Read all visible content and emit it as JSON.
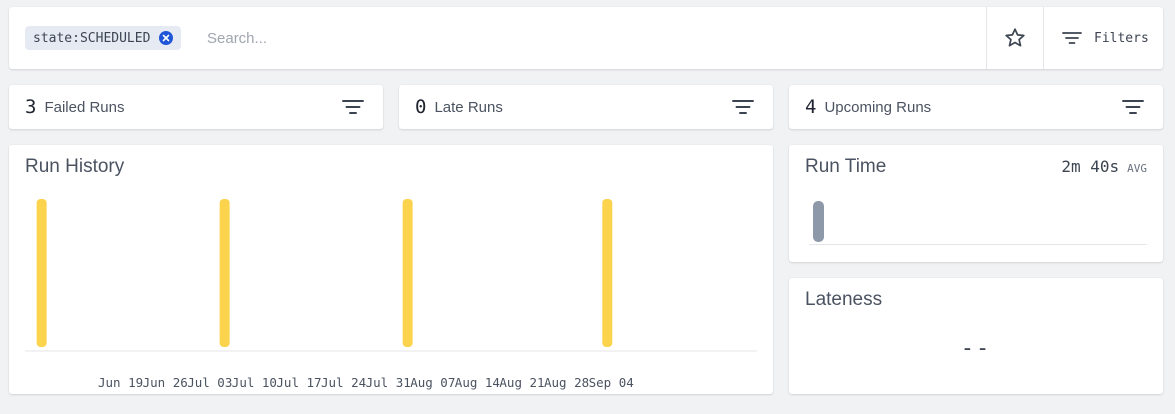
{
  "search": {
    "chip_label": "state:SCHEDULED",
    "placeholder": "Search...",
    "filters_label": "Filters"
  },
  "stats": [
    {
      "count": "3",
      "label": "Failed Runs"
    },
    {
      "count": "0",
      "label": "Late Runs"
    },
    {
      "count": "4",
      "label": "Upcoming Runs"
    }
  ],
  "run_history": {
    "title": "Run History"
  },
  "run_time": {
    "title": "Run Time",
    "avg_value": "2m 40s",
    "avg_label": "AVG"
  },
  "lateness": {
    "title": "Lateness",
    "value": "--"
  },
  "colors": {
    "scheduled_bar": "#fcd34d",
    "chip_remove": "#1f55d6",
    "run_time_bar": "#8d99a8"
  },
  "chart_data": {
    "type": "bar",
    "x_tick_labels": [
      "Jun 19",
      "Jun 26",
      "Jul 03",
      "Jul 10",
      "Jul 17",
      "Jul 24",
      "Jul 31",
      "Aug 07",
      "Aug 14",
      "Aug 21",
      "Aug 28",
      "Sep 04"
    ],
    "x_range": [
      "2021-06-12",
      "2021-09-08"
    ],
    "series": [
      {
        "state": "SCHEDULED",
        "color": "#fcd34d",
        "bars": [
          {
            "date": "2021-06-14",
            "count": 1
          },
          {
            "date": "2021-07-06",
            "count": 1
          },
          {
            "date": "2021-07-28",
            "count": 1
          },
          {
            "date": "2021-08-21",
            "count": 1
          }
        ]
      }
    ],
    "ylim": [
      0,
      1
    ],
    "grid": false
  }
}
